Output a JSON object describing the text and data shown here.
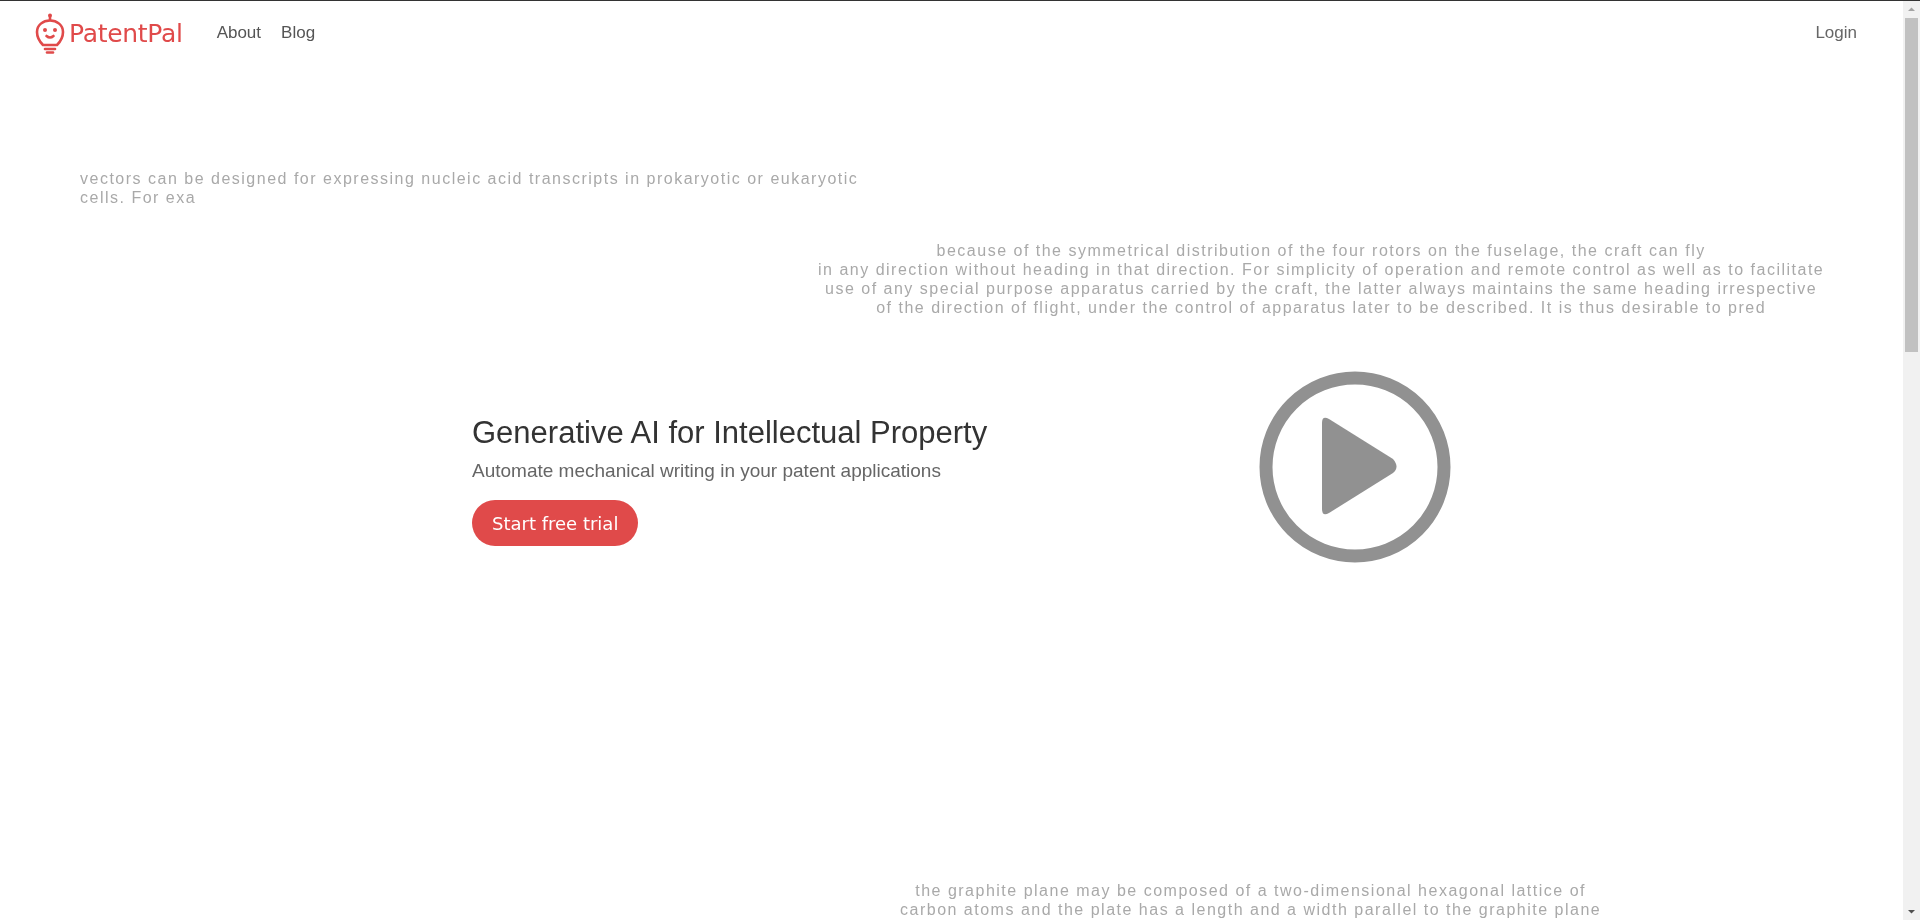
{
  "header": {
    "logo": "PatentPal",
    "nav": [
      {
        "label": "About"
      },
      {
        "label": "Blog"
      }
    ],
    "login": "Login"
  },
  "background_snippets": [
    {
      "lines": [
        "vectors can be designed for expressing nucleic acid transcripts in prokaryotic or eukaryotic",
        "cells. For exa"
      ]
    },
    {
      "lines": [
        "because of the symmetrical distribution of the four rotors on the fuselage, the craft can fly",
        "in any direction without heading in that direction. For simplicity of operation and remote control as well as to facilitate",
        "use of any special purpose apparatus carried by the craft, the latter always maintains the same heading irrespective",
        "of the direction of flight, under the control of apparatus later to be described. It is thus desirable to pred"
      ]
    },
    {
      "lines": [
        "the graphite plane may be composed of a two-dimensional hexagonal lattice of",
        "carbon atoms and the plate has a length and a width parallel to the graphite plane"
      ]
    }
  ],
  "hero": {
    "title": "Generative AI for Intellectual Property",
    "subtitle": "Automate mechanical writing in your patent applications",
    "cta": "Start free trial"
  }
}
